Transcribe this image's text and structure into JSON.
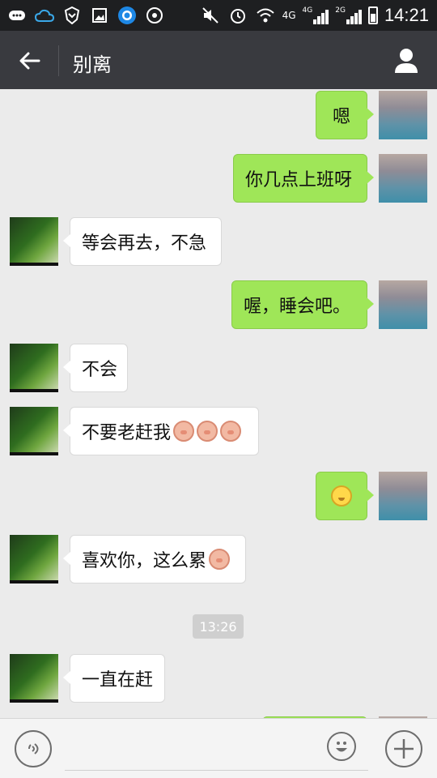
{
  "status_bar": {
    "network_label_1": "4G",
    "network_label_2": "4G",
    "network_label_3": "2G",
    "time": "14:21"
  },
  "chat": {
    "contact_name": "别离"
  },
  "messages": [
    {
      "id": "m1",
      "side": "me",
      "text": "嗯"
    },
    {
      "id": "m2",
      "side": "me",
      "text": "你几点上班呀"
    },
    {
      "id": "m3",
      "side": "them",
      "text": "等会再去，不急"
    },
    {
      "id": "m4",
      "side": "me",
      "text": "喔，睡会吧。"
    },
    {
      "id": "m5",
      "side": "them",
      "text": "不会"
    },
    {
      "id": "m6",
      "side": "them",
      "text": "不要老赶我"
    },
    {
      "id": "m7",
      "side": "me",
      "text": ""
    },
    {
      "id": "m8",
      "side": "them",
      "text": "喜欢你，这么累"
    },
    {
      "id": "m9",
      "side": "them",
      "text": "一直在赶"
    }
  ],
  "timestamp": "13:26",
  "icons": {
    "back": "arrow-left-icon",
    "profile": "person-icon",
    "voice": "voice-icon",
    "emoji": "emoji-icon",
    "plus": "plus-icon"
  }
}
